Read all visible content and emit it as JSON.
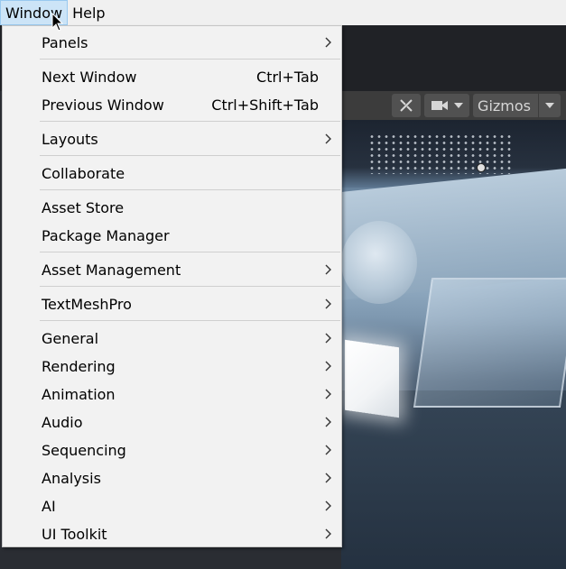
{
  "menubar": {
    "items": [
      {
        "label": "Window"
      },
      {
        "label": "Help"
      }
    ]
  },
  "scene_toolbar": {
    "gizmos_label": "Gizmos"
  },
  "window_menu": {
    "items": [
      {
        "label": "Panels",
        "shortcut": "",
        "submenu": true
      },
      {
        "label": "Next Window",
        "shortcut": "Ctrl+Tab",
        "submenu": false
      },
      {
        "label": "Previous Window",
        "shortcut": "Ctrl+Shift+Tab",
        "submenu": false
      },
      {
        "label": "Layouts",
        "shortcut": "",
        "submenu": true
      },
      {
        "label": "Collaborate",
        "shortcut": "",
        "submenu": false
      },
      {
        "label": "Asset Store",
        "shortcut": "",
        "submenu": false
      },
      {
        "label": "Package Manager",
        "shortcut": "",
        "submenu": false
      },
      {
        "label": "Asset Management",
        "shortcut": "",
        "submenu": true
      },
      {
        "label": "TextMeshPro",
        "shortcut": "",
        "submenu": true
      },
      {
        "label": "General",
        "shortcut": "",
        "submenu": true
      },
      {
        "label": "Rendering",
        "shortcut": "",
        "submenu": true
      },
      {
        "label": "Animation",
        "shortcut": "",
        "submenu": true
      },
      {
        "label": "Audio",
        "shortcut": "",
        "submenu": true
      },
      {
        "label": "Sequencing",
        "shortcut": "",
        "submenu": true
      },
      {
        "label": "Analysis",
        "shortcut": "",
        "submenu": true
      },
      {
        "label": "AI",
        "shortcut": "",
        "submenu": true
      },
      {
        "label": "UI Toolkit",
        "shortcut": "",
        "submenu": true
      }
    ]
  },
  "colors": {
    "menu_background": "#f2f2f2",
    "menubar_active": "#cce4f7",
    "separator": "#cfcfcf"
  }
}
